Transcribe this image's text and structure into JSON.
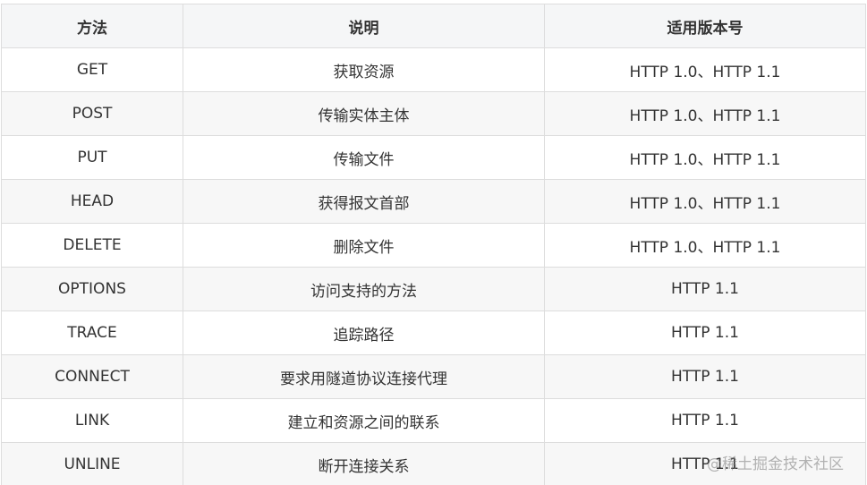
{
  "table": {
    "headers": [
      "方法",
      "说明",
      "适用版本号"
    ],
    "rows": [
      [
        "GET",
        "获取资源",
        "HTTP 1.0、HTTP 1.1"
      ],
      [
        "POST",
        "传输实体主体",
        "HTTP 1.0、HTTP 1.1"
      ],
      [
        "PUT",
        "传输文件",
        "HTTP 1.0、HTTP 1.1"
      ],
      [
        "HEAD",
        "获得报文首部",
        "HTTP 1.0、HTTP 1.1"
      ],
      [
        "DELETE",
        "删除文件",
        "HTTP 1.0、HTTP 1.1"
      ],
      [
        "OPTIONS",
        "访问支持的方法",
        "HTTP 1.1"
      ],
      [
        "TRACE",
        "追踪路径",
        "HTTP 1.1"
      ],
      [
        "CONNECT",
        "要求用隧道协议连接代理",
        "HTTP 1.1"
      ],
      [
        "LINK",
        "建立和资源之间的联系",
        "HTTP 1.1"
      ],
      [
        "UNLINE",
        "断开连接关系",
        "HTTP 1.1"
      ]
    ]
  },
  "watermark": "@稀土掘金技术社区"
}
